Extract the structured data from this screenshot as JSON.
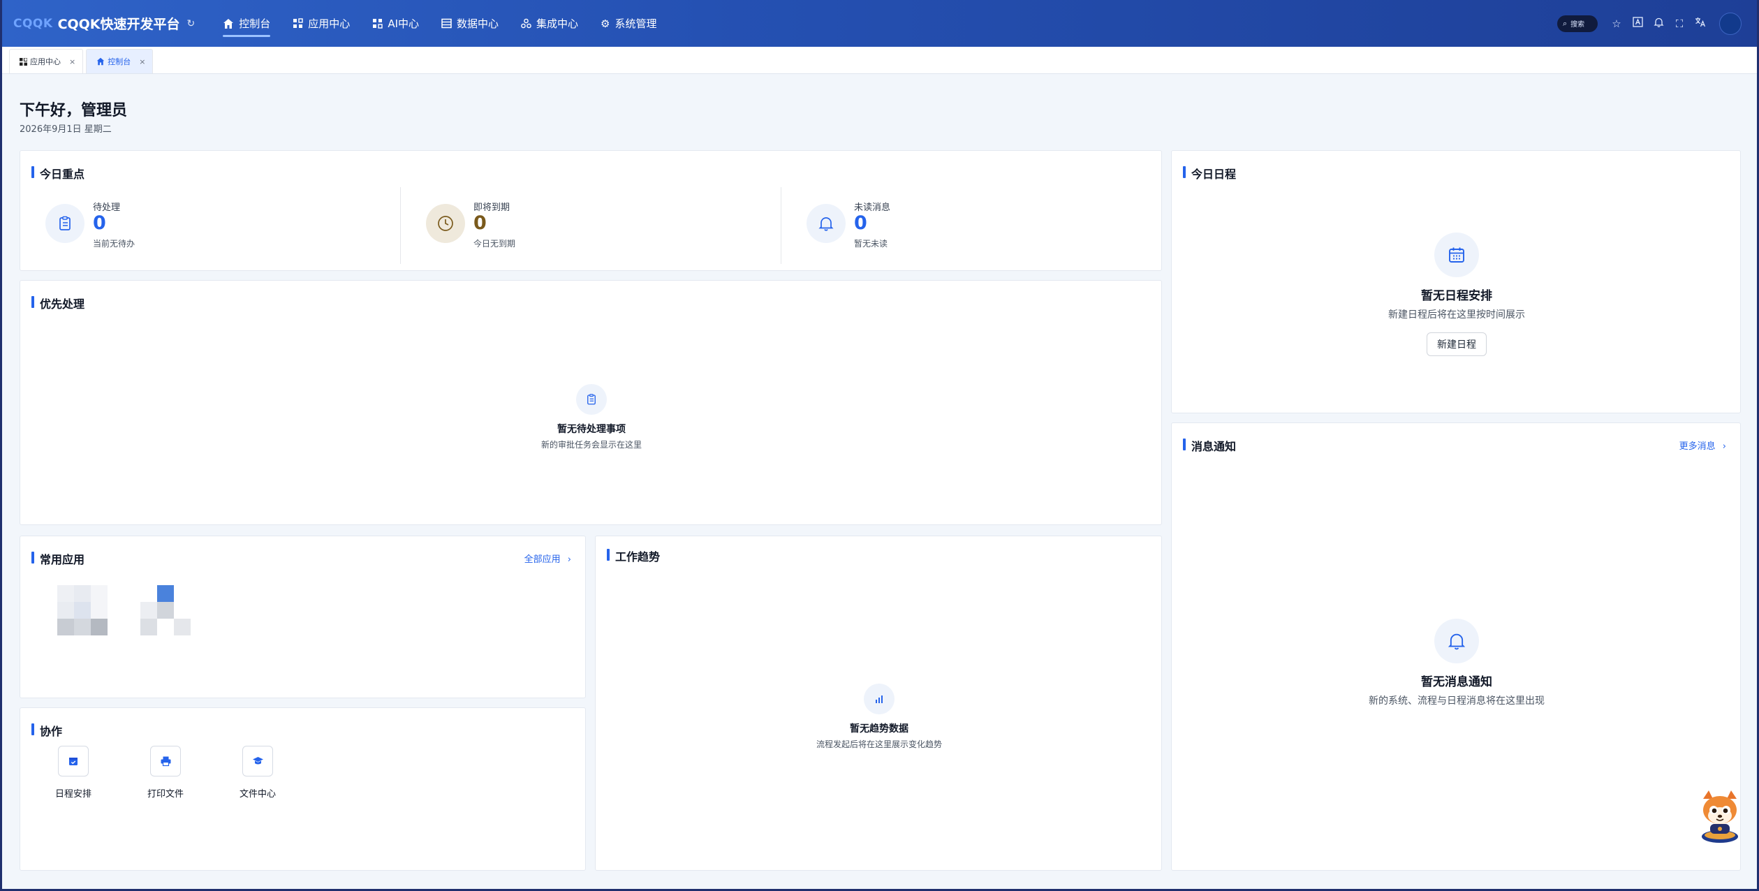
{
  "header": {
    "logo_mark": "CQQK",
    "brand": "CQQK快速开发平台",
    "nav": [
      {
        "label": "控制台",
        "icon": "home-icon",
        "active": true
      },
      {
        "label": "应用中心",
        "icon": "apps-grid-icon"
      },
      {
        "label": "AI中心",
        "icon": "ai-grid-icon"
      },
      {
        "label": "数据中心",
        "icon": "table-icon"
      },
      {
        "label": "集成中心",
        "icon": "integration-icon"
      },
      {
        "label": "系统管理",
        "icon": "gear-icon"
      }
    ],
    "search_label": "搜索"
  },
  "tabs": [
    {
      "label": "应用中心",
      "close": "×"
    },
    {
      "label": "控制台",
      "close": "×",
      "active": true
    }
  ],
  "greeting": "下午好，管理员",
  "date": "2026年9月1日 星期二",
  "today_focus": {
    "title": "今日重点",
    "kpis": [
      {
        "label": "待处理",
        "value": "0",
        "sub": "当前无待办",
        "icon": "clipboard-icon",
        "color": "#2563eb"
      },
      {
        "label": "即将到期",
        "value": "0",
        "sub": "今日无到期",
        "icon": "clock-icon",
        "color": "#7a5a1c"
      },
      {
        "label": "未读消息",
        "value": "0",
        "sub": "暂无未读",
        "icon": "bell-icon",
        "color": "#2563eb"
      }
    ]
  },
  "priority": {
    "title": "优先处理",
    "empty_title": "暂无待处理事项",
    "empty_desc": "新的审批任务会显示在这里"
  },
  "apps": {
    "title": "常用应用",
    "link": "全部应用",
    "link_arrow": "›"
  },
  "collab": {
    "title": "协作",
    "items": [
      {
        "label": "日程安排",
        "icon": "calendar-check-icon"
      },
      {
        "label": "打印文件",
        "icon": "printer-icon"
      },
      {
        "label": "文件中心",
        "icon": "graduation-cap-icon"
      }
    ]
  },
  "trend": {
    "title": "工作趋势",
    "empty_title": "暂无趋势数据",
    "empty_desc": "流程发起后将在这里展示变化趋势"
  },
  "schedule": {
    "title": "今日日程",
    "empty_title": "暂无日程安排",
    "empty_desc": "新建日程后将在这里按时间展示",
    "button": "新建日程"
  },
  "messages": {
    "title": "消息通知",
    "link": "更多消息",
    "link_arrow": "›",
    "empty_title": "暂无消息通知",
    "empty_desc": "新的系统、流程与日程消息将在这里出现"
  },
  "colors": {
    "accent": "#2563eb",
    "header": "#2551b3"
  }
}
